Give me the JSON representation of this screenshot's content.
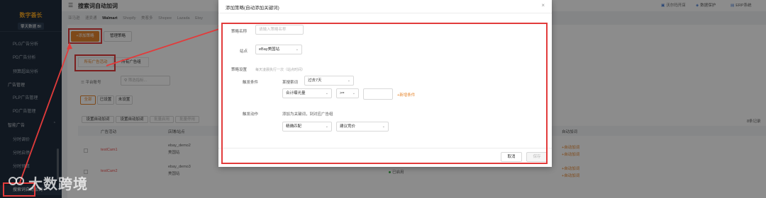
{
  "brand": {
    "title": "数字荟长",
    "tag": "擎天数据 BI"
  },
  "sidebar": {
    "items": [
      {
        "label": "PLG广告分析",
        "type": "sub"
      },
      {
        "label": "PD广告分析",
        "type": "sub"
      },
      {
        "label": "预算超出分析",
        "type": "sub"
      },
      {
        "label": "广告管理",
        "type": "group"
      },
      {
        "label": "PLP广告管理",
        "type": "sub"
      },
      {
        "label": "PD广告管理",
        "type": "sub"
      },
      {
        "label": "智能广告",
        "type": "group"
      },
      {
        "label": "分时调价",
        "type": "sub"
      },
      {
        "label": "分时启停",
        "type": "sub"
      },
      {
        "label": "分时预算",
        "type": "sub"
      },
      {
        "label": "搜索词自动加词",
        "type": "sub"
      }
    ]
  },
  "header": {
    "page_title": "搜索词自动加词",
    "links": [
      "沃尔玛开店",
      "数据保护",
      "ERP系统"
    ]
  },
  "platforms": [
    "亚马逊",
    "速卖通",
    "Walmart",
    "Shopify",
    "美客多",
    "Shopee",
    "Lazada",
    "Etsy"
  ],
  "toolbar": {
    "add_strategy": "+添加策略",
    "manage_strategy": "管理策略"
  },
  "tabs": {
    "all_ads": "所有广告活动",
    "all_groups": "所有广告组"
  },
  "filters": {
    "platform_account": "平台账号",
    "filter_placeholder": "筛选指标..."
  },
  "status_tabs": [
    "全部",
    "已设置",
    "未设置"
  ],
  "bulk_buttons": [
    "设置自动加词",
    "设置自动加词",
    "批量启用",
    "批量停用"
  ],
  "records": "8条记录",
  "table": {
    "headers": [
      "广告活动",
      "店铺/站点",
      "自动加词"
    ],
    "rows": [
      {
        "campaign": "testCam1",
        "store": "ebay_demo2",
        "site": "美国站",
        "status": "",
        "actions": [
          "+自动加词",
          "+自动加词"
        ]
      },
      {
        "campaign": "testCam2",
        "store": "ebay_demo3",
        "site": "美国站",
        "status": "已启用",
        "actions": [
          "+自动加词",
          "+自动加词"
        ]
      }
    ]
  },
  "modal": {
    "title": "添加策略(自动添加关键词)",
    "name_label": "策略名称",
    "name_placeholder": "请输入策略名称",
    "site_label": "站点",
    "site_value": "eBay美国站",
    "settings_label": "策略设置",
    "settings_hint": "每天凌晨执行一次（站点时间）",
    "trigger_label": "触发条件",
    "trigger_prefix": "某搜索词",
    "period_value": "过去7天",
    "metric_value": "合计曝光量",
    "operator_value": ">=",
    "threshold_value": "",
    "add_condition": "+新增条件",
    "action_label": "触发动作",
    "action_text": "添加为关键词，到对应广告组",
    "match_value": "精确匹配",
    "bid_value": "建议竞价",
    "cancel": "取消",
    "confirm": "保存"
  },
  "watermark": "大数跨境"
}
